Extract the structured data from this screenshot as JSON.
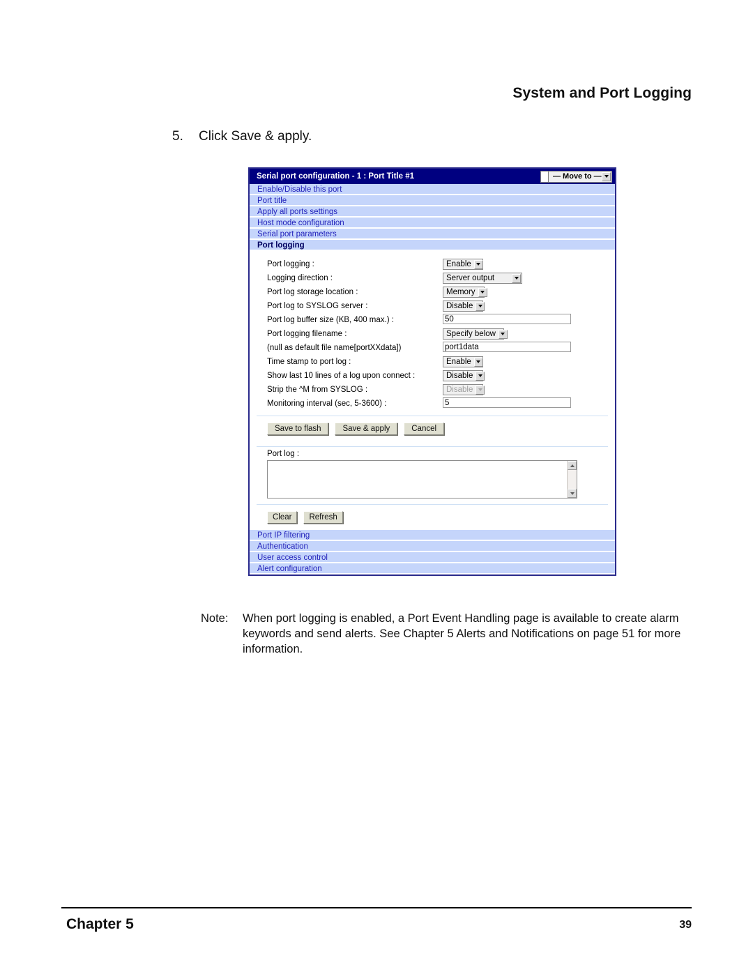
{
  "page": {
    "running_head": "System and Port Logging",
    "step_number": "5.",
    "step_text": "Click Save & apply.",
    "footer_left": "Chapter 5",
    "footer_right": "39"
  },
  "note": {
    "label": "Note:",
    "text": "When port logging is enabled, a Port Event Handling page is available to create alarm keywords and send alerts. See Chapter 5 Alerts and Notifications on page 51 for more information."
  },
  "app": {
    "titlebar": {
      "title": "Serial port configuration - 1 : Port Title #1",
      "move_to_label": "— Move to —",
      "move_to_icon": "chevron-down-icon"
    },
    "nav_top": [
      {
        "label": "Enable/Disable this port",
        "active": false
      },
      {
        "label": "Port title",
        "active": false
      },
      {
        "label": "Apply all ports settings",
        "active": false
      },
      {
        "label": "Host mode configuration",
        "active": false
      },
      {
        "label": "Serial port parameters",
        "active": false
      },
      {
        "label": "Port logging",
        "active": true
      }
    ],
    "fields": [
      {
        "label": "Port logging :",
        "type": "select",
        "value": "Enable",
        "width": "w-enable",
        "disabled": false
      },
      {
        "label": "Logging direction :",
        "type": "select",
        "value": "Server output",
        "width": "w-direction",
        "disabled": false
      },
      {
        "label": "Port log storage location :",
        "type": "select",
        "value": "Memory",
        "width": "w-memory",
        "disabled": false
      },
      {
        "label": "Port log to SYSLOG server :",
        "type": "select",
        "value": "Disable",
        "width": "w-disable",
        "disabled": false
      },
      {
        "label": "Port log buffer size (KB, 400 max.) :",
        "type": "text",
        "value": "50",
        "disabled": false
      },
      {
        "label": "Port logging filename :",
        "type": "select",
        "value": "Specify below",
        "width": "w-specify",
        "disabled": false
      },
      {
        "label": "(null as default file name[portXXdata])",
        "type": "text",
        "value": "port1data",
        "disabled": false
      },
      {
        "label": "Time stamp to port log :",
        "type": "select",
        "value": "Enable",
        "width": "w-enable",
        "disabled": false
      },
      {
        "label": "Show last 10 lines of a log upon connect :",
        "type": "select",
        "value": "Disable",
        "width": "w-disable",
        "disabled": false
      },
      {
        "label": "Strip the ^M from SYSLOG :",
        "type": "select",
        "value": "Disable",
        "width": "w-disable",
        "disabled": true
      },
      {
        "label": "Monitoring interval (sec, 5-3600) :",
        "type": "text",
        "value": "5",
        "disabled": false
      }
    ],
    "form_buttons": [
      {
        "label": "Save to flash"
      },
      {
        "label": "Save & apply"
      },
      {
        "label": "Cancel"
      }
    ],
    "port_log": {
      "label": "Port log :",
      "value": "",
      "scroll_up_icon": "triangle-up-icon",
      "scroll_down_icon": "triangle-down-icon"
    },
    "log_buttons": [
      {
        "label": "Clear"
      },
      {
        "label": "Refresh"
      }
    ],
    "nav_bottom": [
      {
        "label": "Port IP filtering"
      },
      {
        "label": "Authentication"
      },
      {
        "label": "User access control"
      },
      {
        "label": "Alert configuration"
      }
    ],
    "colors": {
      "titlebar_bg": "#000080",
      "nav_row_bg": "#c5d5fb",
      "nav_row_text": "#2222bb",
      "panel_border": "#2a2a8c",
      "separator": "#cfe0f5"
    }
  }
}
